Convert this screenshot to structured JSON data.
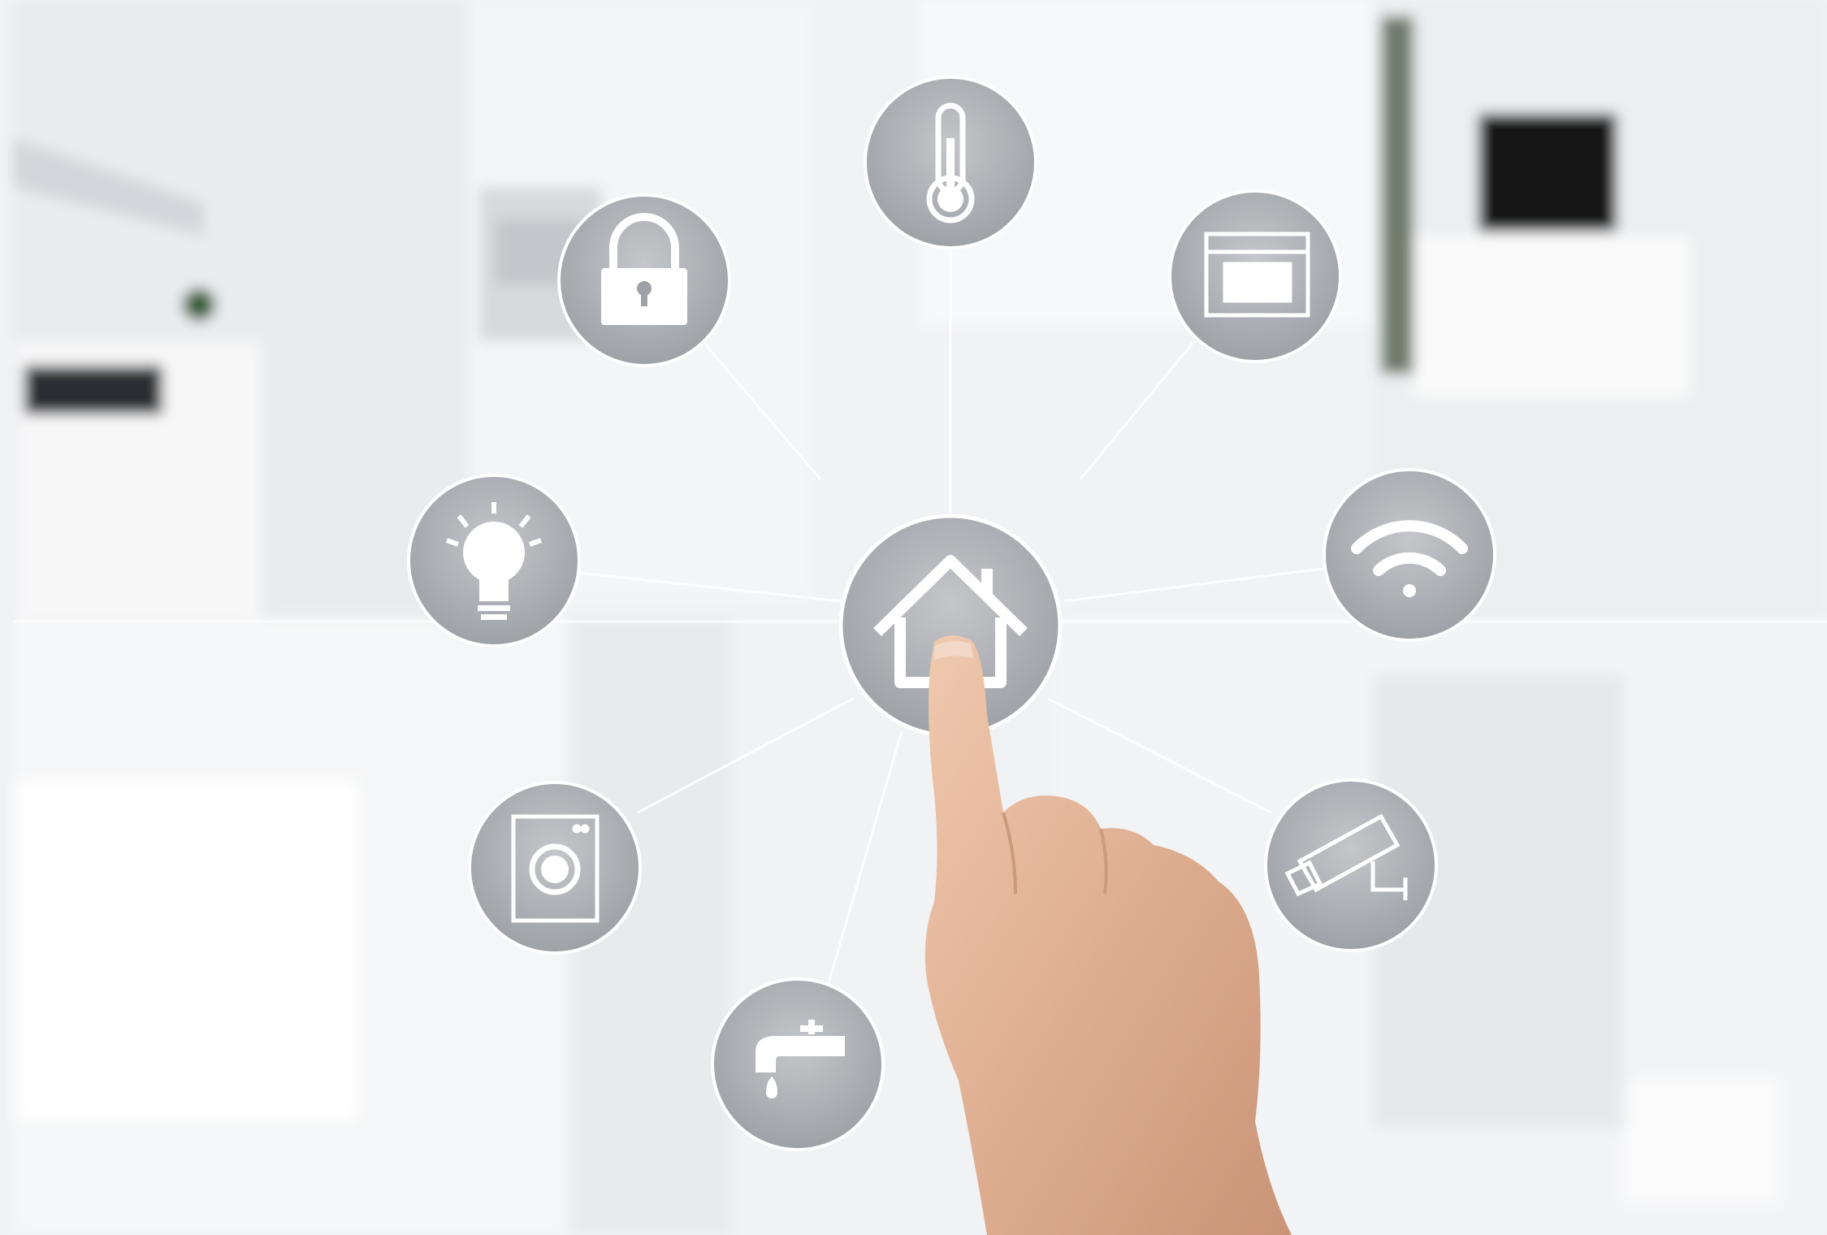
{
  "scene": {
    "colors": {
      "accent_bar": "#f2b705",
      "node_fill": "#a9abb0",
      "node_ring": "#ffffff",
      "connector": "#ffffff",
      "room_bg": "#eef0f2",
      "skin": "#e3b59a"
    },
    "hub": {
      "icon": "home-icon"
    },
    "nodes": [
      {
        "icon": "thermometer-icon"
      },
      {
        "icon": "lock-icon"
      },
      {
        "icon": "oven-icon"
      },
      {
        "icon": "lightbulb-icon"
      },
      {
        "icon": "wifi-icon"
      },
      {
        "icon": "washing-machine-icon"
      },
      {
        "icon": "security-camera-icon"
      },
      {
        "icon": "water-faucet-icon"
      }
    ],
    "subject": "hand-pointing"
  }
}
